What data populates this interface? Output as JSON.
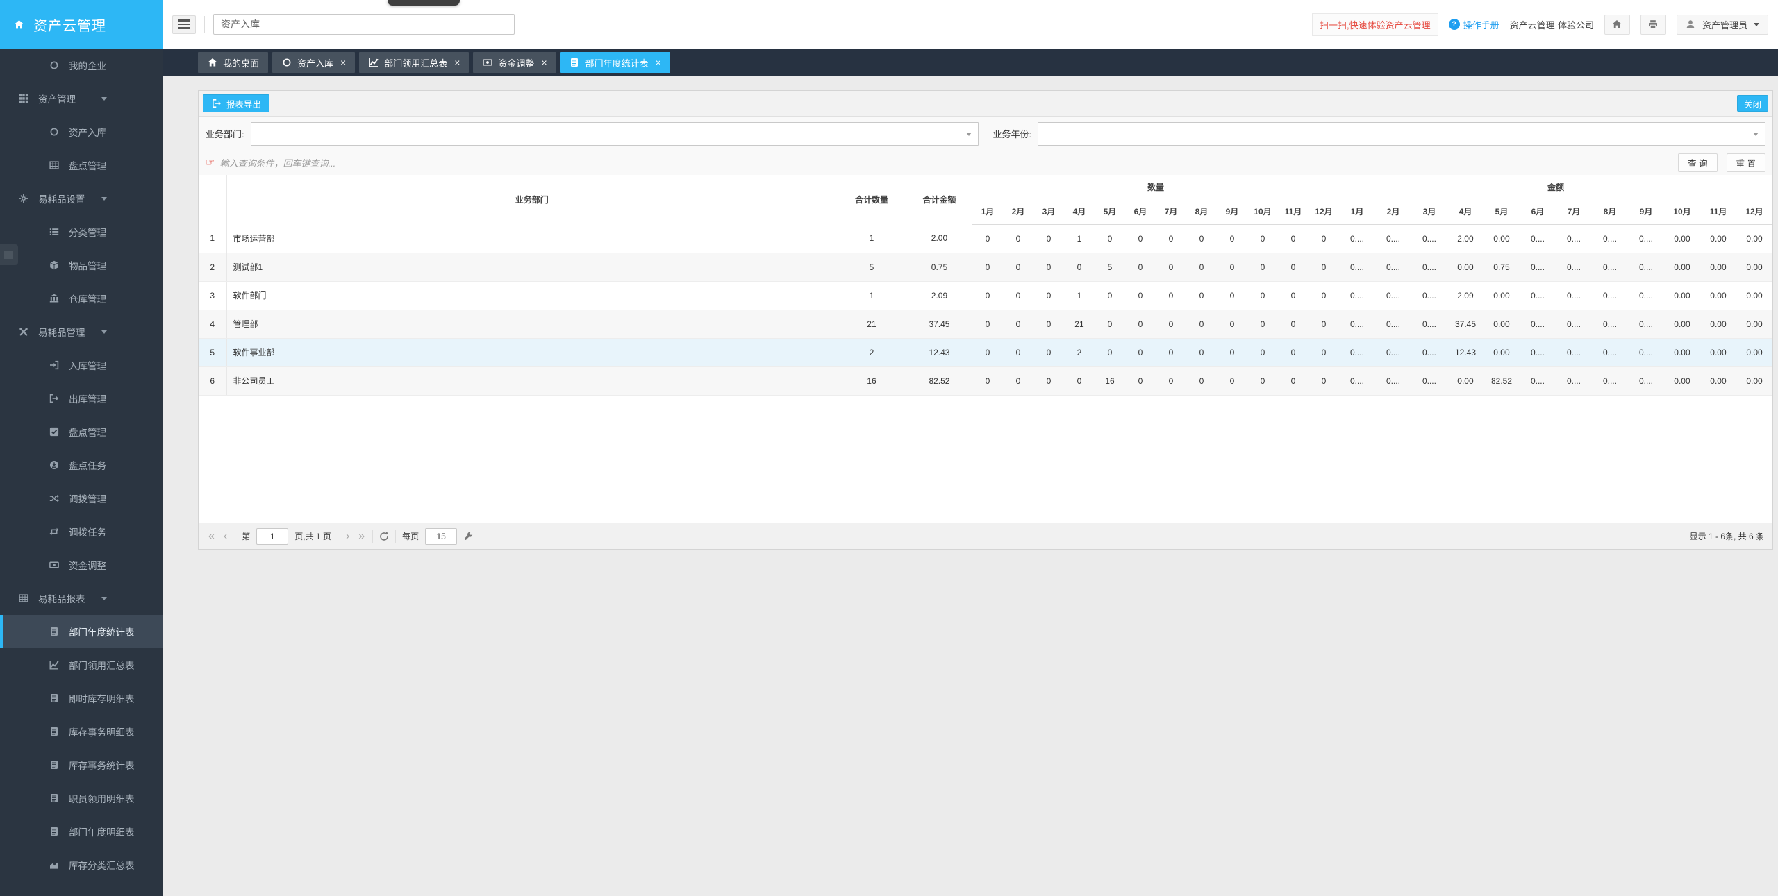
{
  "app": {
    "title": "资产云管理"
  },
  "topbar": {
    "search_value": "资产入库",
    "scan_link": "扫一扫,快速体验资产云管理",
    "manual_link": "操作手册",
    "company": "资产云管理-体验公司",
    "user": "资产管理员"
  },
  "colors": {
    "accent": "#2db7f5",
    "red": "#e64c42",
    "link": "#1e9ef0",
    "highlight_row": "#e8f4fb",
    "sidebar_bg": "#2b3541"
  },
  "sidebar": {
    "items": [
      {
        "label": "我的企业",
        "icon": "circle-o",
        "level": "child",
        "caret": false,
        "active": false
      },
      {
        "label": "资产管理",
        "icon": "th",
        "level": "group",
        "caret": true,
        "active": false
      },
      {
        "label": "资产入库",
        "icon": "circle-o",
        "level": "child",
        "caret": false,
        "active": false
      },
      {
        "label": "盘点管理",
        "icon": "table",
        "level": "child",
        "caret": false,
        "active": false
      },
      {
        "label": "易耗品设置",
        "icon": "gear",
        "level": "group",
        "caret": true,
        "active": false
      },
      {
        "label": "分类管理",
        "icon": "list",
        "level": "child",
        "caret": false,
        "active": false
      },
      {
        "label": "物品管理",
        "icon": "cube",
        "level": "child",
        "caret": false,
        "active": false
      },
      {
        "label": "仓库管理",
        "icon": "bank",
        "level": "child",
        "caret": false,
        "active": false
      },
      {
        "label": "易耗品管理",
        "icon": "tools",
        "level": "group",
        "caret": true,
        "active": false
      },
      {
        "label": "入库管理",
        "icon": "sign-in",
        "level": "child",
        "caret": false,
        "active": false
      },
      {
        "label": "出库管理",
        "icon": "sign-out",
        "level": "child",
        "caret": false,
        "active": false
      },
      {
        "label": "盘点管理",
        "icon": "check-square",
        "level": "child",
        "caret": false,
        "active": false
      },
      {
        "label": "盘点任务",
        "icon": "task-circle",
        "level": "child",
        "caret": false,
        "active": false
      },
      {
        "label": "调拨管理",
        "icon": "shuffle",
        "level": "child",
        "caret": false,
        "active": false
      },
      {
        "label": "调拨任务",
        "icon": "retweet",
        "level": "child",
        "caret": false,
        "active": false
      },
      {
        "label": "资金调整",
        "icon": "money",
        "level": "child",
        "caret": false,
        "active": false
      },
      {
        "label": "易耗品报表",
        "icon": "table",
        "level": "group",
        "caret": true,
        "active": false
      },
      {
        "label": "部门年度统计表",
        "icon": "report",
        "level": "child",
        "caret": false,
        "active": true
      },
      {
        "label": "部门领用汇总表",
        "icon": "line-chart",
        "level": "child",
        "caret": false,
        "active": false
      },
      {
        "label": "即时库存明细表",
        "icon": "report",
        "level": "child",
        "caret": false,
        "active": false
      },
      {
        "label": "库存事务明细表",
        "icon": "report",
        "level": "child",
        "caret": false,
        "active": false
      },
      {
        "label": "库存事务统计表",
        "icon": "report",
        "level": "child",
        "caret": false,
        "active": false
      },
      {
        "label": "职员领用明细表",
        "icon": "report",
        "level": "child",
        "caret": false,
        "active": false
      },
      {
        "label": "部门年度明细表",
        "icon": "report",
        "level": "child",
        "caret": false,
        "active": false
      },
      {
        "label": "库存分类汇总表",
        "icon": "area-chart",
        "level": "child",
        "caret": false,
        "active": false
      }
    ]
  },
  "tabs": [
    {
      "label": "我的桌面",
      "icon": "home",
      "closable": false,
      "active": false
    },
    {
      "label": "资产入库",
      "icon": "circle-o",
      "closable": true,
      "active": false
    },
    {
      "label": "部门领用汇总表",
      "icon": "line-chart",
      "closable": true,
      "active": false
    },
    {
      "label": "资金调整",
      "icon": "money",
      "closable": true,
      "active": false
    },
    {
      "label": "部门年度统计表",
      "icon": "report",
      "closable": true,
      "active": true
    }
  ],
  "toolbar": {
    "export_label": "报表导出",
    "close_label": "关闭"
  },
  "filters": {
    "dept_label": "业务部门:",
    "dept_value": "",
    "year_label": "业务年份:",
    "year_value": ""
  },
  "hint": {
    "text": "输入查询条件，回车键查询...",
    "search_label": "查 询",
    "reset_label": "重 置"
  },
  "table": {
    "headers": {
      "dept": "业务部门",
      "total_qty": "合计数量",
      "total_amt": "合计金额",
      "qty_group": "数量",
      "amt_group": "金额"
    },
    "months": [
      "1月",
      "2月",
      "3月",
      "4月",
      "5月",
      "6月",
      "7月",
      "8月",
      "9月",
      "10月",
      "11月",
      "12月"
    ],
    "rows": [
      {
        "no": "1",
        "dept": "市场运营部",
        "total_qty": "1",
        "total_amt": "2.00",
        "qty": [
          "0",
          "0",
          "0",
          "1",
          "0",
          "0",
          "0",
          "0",
          "0",
          "0",
          "0",
          "0"
        ],
        "amt": [
          "0....",
          "0....",
          "0....",
          "2.00",
          "0.00",
          "0....",
          "0....",
          "0....",
          "0....",
          "0.00",
          "0.00",
          "0.00"
        ]
      },
      {
        "no": "2",
        "dept": "测试部1",
        "total_qty": "5",
        "total_amt": "0.75",
        "qty": [
          "0",
          "0",
          "0",
          "0",
          "5",
          "0",
          "0",
          "0",
          "0",
          "0",
          "0",
          "0"
        ],
        "amt": [
          "0....",
          "0....",
          "0....",
          "0.00",
          "0.75",
          "0....",
          "0....",
          "0....",
          "0....",
          "0.00",
          "0.00",
          "0.00"
        ]
      },
      {
        "no": "3",
        "dept": "软件部门",
        "total_qty": "1",
        "total_amt": "2.09",
        "qty": [
          "0",
          "0",
          "0",
          "1",
          "0",
          "0",
          "0",
          "0",
          "0",
          "0",
          "0",
          "0"
        ],
        "amt": [
          "0....",
          "0....",
          "0....",
          "2.09",
          "0.00",
          "0....",
          "0....",
          "0....",
          "0....",
          "0.00",
          "0.00",
          "0.00"
        ]
      },
      {
        "no": "4",
        "dept": "管理部",
        "total_qty": "21",
        "total_amt": "37.45",
        "qty": [
          "0",
          "0",
          "0",
          "21",
          "0",
          "0",
          "0",
          "0",
          "0",
          "0",
          "0",
          "0"
        ],
        "amt": [
          "0....",
          "0....",
          "0....",
          "37.45",
          "0.00",
          "0....",
          "0....",
          "0....",
          "0....",
          "0.00",
          "0.00",
          "0.00"
        ]
      },
      {
        "no": "5",
        "dept": "软件事业部",
        "total_qty": "2",
        "total_amt": "12.43",
        "qty": [
          "0",
          "0",
          "0",
          "2",
          "0",
          "0",
          "0",
          "0",
          "0",
          "0",
          "0",
          "0"
        ],
        "amt": [
          "0....",
          "0....",
          "0....",
          "12.43",
          "0.00",
          "0....",
          "0....",
          "0....",
          "0....",
          "0.00",
          "0.00",
          "0.00"
        ]
      },
      {
        "no": "6",
        "dept": "非公司员工",
        "total_qty": "16",
        "total_amt": "82.52",
        "qty": [
          "0",
          "0",
          "0",
          "0",
          "16",
          "0",
          "0",
          "0",
          "0",
          "0",
          "0",
          "0"
        ],
        "amt": [
          "0....",
          "0....",
          "0....",
          "0.00",
          "82.52",
          "0....",
          "0....",
          "0....",
          "0....",
          "0.00",
          "0.00",
          "0.00"
        ]
      }
    ]
  },
  "pagination": {
    "first_icon": "«",
    "prev_icon": "‹",
    "next_icon": "›",
    "last_icon": "»",
    "page_label": "第",
    "page_value": "1",
    "page_info": "页,共 1 页",
    "per_page_label": "每页",
    "per_page_value": "15",
    "summary": "显示 1 - 6条, 共 6 条"
  }
}
